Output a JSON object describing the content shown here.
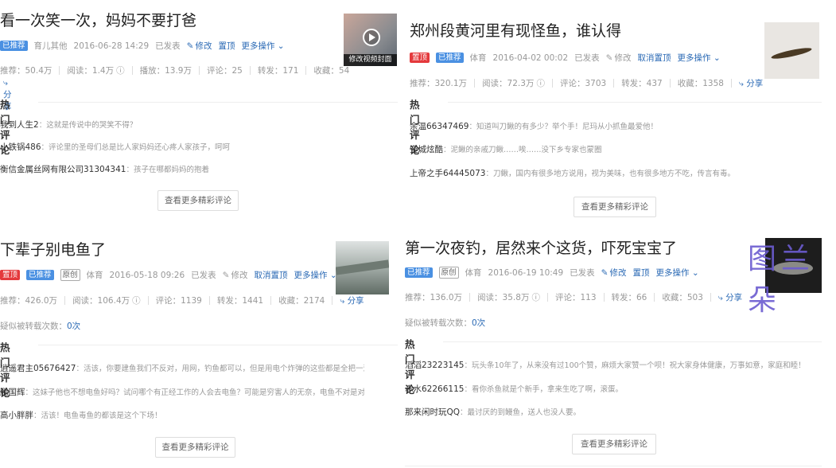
{
  "cards": [
    {
      "title": "看一次笑一次，妈妈不要打爸",
      "badges": [
        "已推荐"
      ],
      "category": "育儿其他",
      "date": "2016-06-28 14:29",
      "status": "已发表",
      "edit": "修改",
      "pin": "置顶",
      "more": "更多操作",
      "stats": [
        "推荐：50.4万",
        "阅读：1.4万",
        "播放：13.9万",
        "评论：25",
        "转发：171",
        "收藏：54"
      ],
      "share": "分享",
      "thumb_caption": "修改视频封面",
      "hot_label": "热门评论",
      "comments": [
        {
          "user": "我到人生2",
          "text": "：这就是传说中的哭笑不得？"
        },
        {
          "user": "小铁锅486",
          "text": "：评论里的圣母们总是比人家妈妈还心疼人家孩子，呵呵"
        },
        {
          "user": "衡信金属丝网有限公司31304341",
          "text": "：孩子在哪都妈妈的抱着"
        }
      ],
      "more_comments": "查看更多精彩评论"
    },
    {
      "title": "郑州段黄河里有现怪鱼，谁认得",
      "badges": [
        "置顶",
        "已推荐"
      ],
      "category": "体育",
      "date": "2016-04-02 00:02",
      "status": "已发表",
      "edit": "修改",
      "pin": "取消置顶",
      "more": "更多操作",
      "stats": [
        "推荐：320.1万",
        "阅读：72.3万",
        "评论：3703",
        "转发：437",
        "收藏：1358"
      ],
      "share": "分享",
      "hot_label": "热门评论",
      "comments": [
        {
          "user": "余温66347469",
          "text": "：知道叫刀鳅的有多少？举个手！尼玛从小抓鱼最爱他！"
        },
        {
          "user": "空城炫酷",
          "text": "：泥鳅的亲戚刀鳅……唉……没下乡专家也蒙圈"
        },
        {
          "user": "上帝之手64445073",
          "text": "：刀鳅，国内有很多地方说用，视为美味，也有很多地方不吃，传言有毒。"
        }
      ],
      "more_comments": "查看更多精彩评论"
    },
    {
      "title": "下辈子别电鱼了",
      "badges": [
        "置顶",
        "已推荐",
        "原创"
      ],
      "category": "体育",
      "date": "2016-05-18 09:26",
      "status": "已发表",
      "edit": "修改",
      "pin": "取消置顶",
      "more": "更多操作",
      "stats": [
        "推荐：426.0万",
        "阅读：106.4万",
        "评论：1139",
        "转发：1441",
        "收藏：2174"
      ],
      "share": "分享",
      "reprint_label": "疑似被转载次数：",
      "reprint_count": "0次",
      "hot_label": "热门评论",
      "comments": [
        {
          "user": "逍遥君主05676427",
          "text": "：活该，你要建鱼我们不反对，用网，钓鱼都可以，但是用电个炸弹的这些都是全把一河的生物都赶尽杀绝的..."
        },
        {
          "user": "鹏国辉",
          "text": "：这妹子他也不想电鱼好吗？试问哪个有正经工作的人会去电鱼？可能是穷害人的无奈，电鱼不对是对生命的藐视是肯定..."
        },
        {
          "user": "高小胖胖",
          "text": "：活该！电鱼毒鱼的都该是这个下场！"
        }
      ],
      "more_comments": "查看更多精彩评论"
    },
    {
      "title": "第一次夜钓，居然来个这货，吓死宝宝了",
      "badges": [
        "已推荐",
        "原创"
      ],
      "category": "体育",
      "date": "2016-06-19 10:49",
      "status": "已发表",
      "edit": "修改",
      "pin": "置顶",
      "more": "更多操作",
      "stats": [
        "推荐：136.0万",
        "阅读：35.8万",
        "评论：113",
        "转发：66",
        "收藏：503"
      ],
      "share": "分享",
      "reprint_label": "疑似被转载次数：",
      "reprint_count": "0次",
      "hot_label": "热门评论",
      "comments": [
        {
          "user": "滔滔23223145",
          "text": "：玩头条10年了，从来没有过100个赞，麻烦大家赞一个呗！祝大家身体健康，万事如意，家庭和睦！"
        },
        {
          "user": "赤水62266115",
          "text": "：看你杀鱼就是个新手，拿来生吃了啊，滚蛋。"
        },
        {
          "user": "那来闲时玩QQ",
          "text": "：最讨厌的到鳗鱼，送人也没人要。"
        }
      ],
      "more_comments": "查看更多精彩评论"
    }
  ],
  "watermark": "图兰朵",
  "colors": {
    "accent": "#2b6ab5",
    "badge_red": "#e4393c",
    "badge_blue": "#4a90e2"
  }
}
